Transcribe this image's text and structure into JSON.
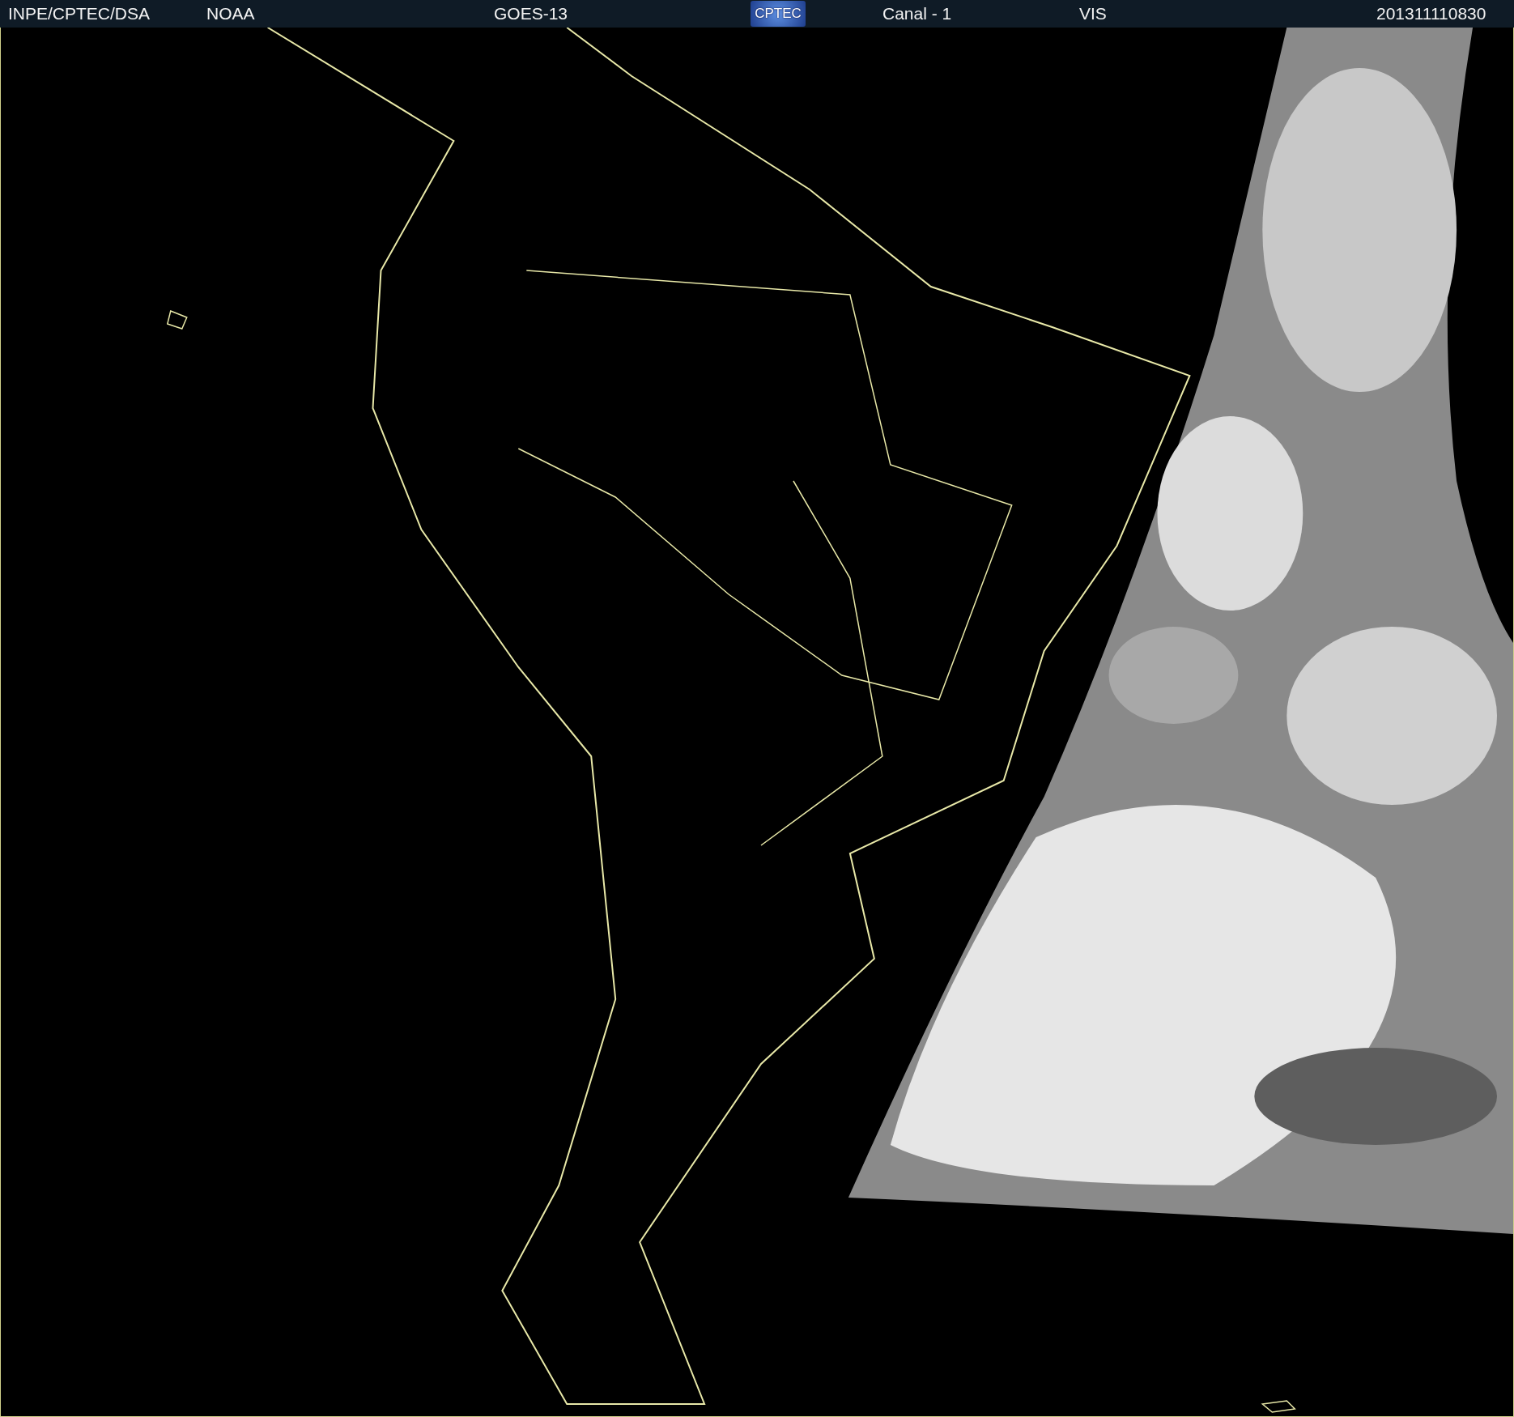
{
  "header": {
    "source": "INPE/CPTEC/DSA",
    "agency": "NOAA",
    "satellite": "GOES-13",
    "logo": "CPTEC",
    "channel": "Canal - 1",
    "band": "VIS",
    "timestamp": "201311110830"
  }
}
